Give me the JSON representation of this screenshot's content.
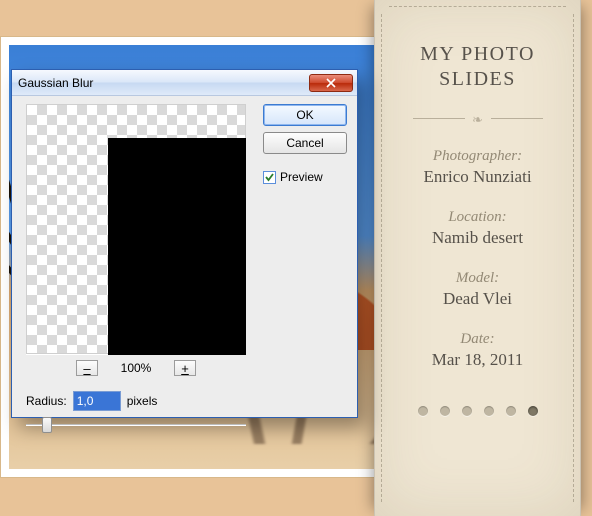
{
  "bookmark": {
    "title_line1": "MY PHOTO",
    "title_line2": "SLIDES",
    "groups": [
      {
        "label": "Photographer:",
        "value": "Enrico Nunziati"
      },
      {
        "label": "Location:",
        "value": "Namib desert"
      },
      {
        "label": "Model:",
        "value": "Dead Vlei"
      },
      {
        "label": "Date:",
        "value": "Mar 18, 2011"
      }
    ],
    "num_dots": 6,
    "active_dot": 5
  },
  "dialog": {
    "title": "Gaussian Blur",
    "ok_label": "OK",
    "cancel_label": "Cancel",
    "preview_label": "Preview",
    "preview_checked": true,
    "zoom": {
      "out": "–",
      "in": "+",
      "label": "100%"
    },
    "radius": {
      "label": "Radius:",
      "value": "1,0",
      "unit": "pixels"
    }
  }
}
